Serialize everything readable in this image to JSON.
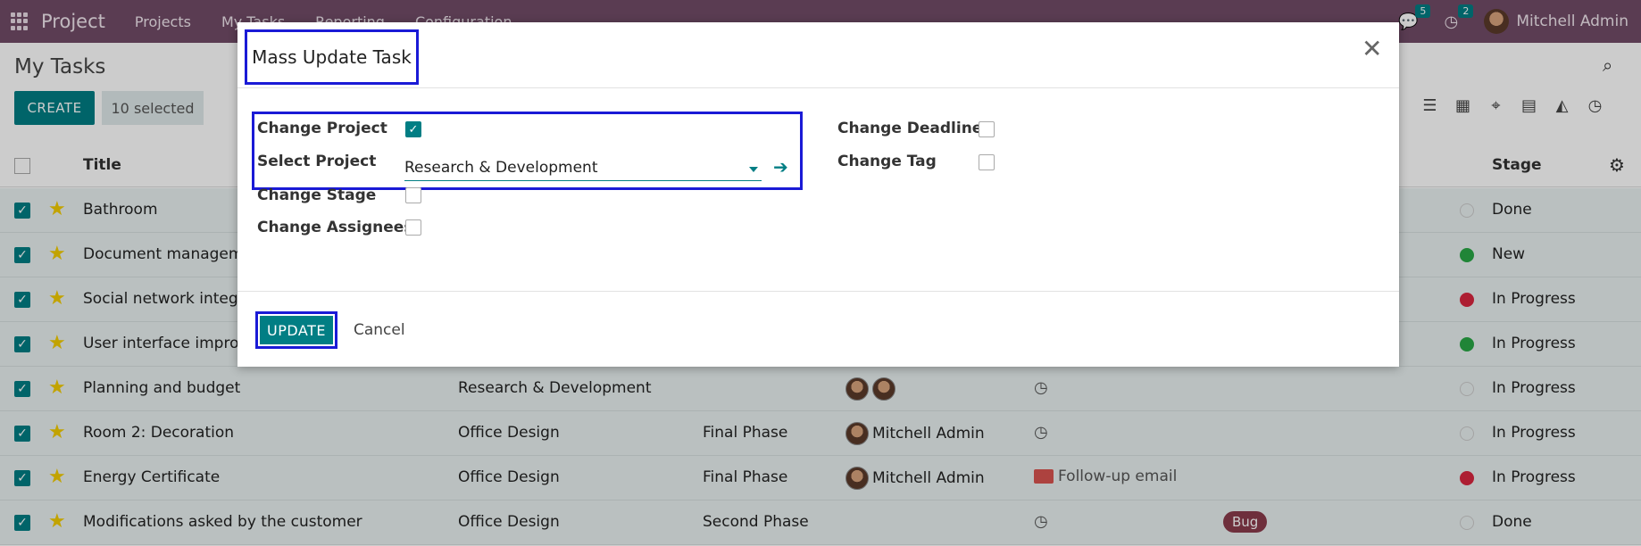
{
  "navbar": {
    "app_name": "Project",
    "menu": [
      "Projects",
      "My Tasks",
      "Reporting",
      "Configuration"
    ],
    "messages_count": "5",
    "activities_count": "2",
    "user_name": "Mitchell Admin"
  },
  "control_panel": {
    "page_title": "My Tasks",
    "create_label": "CREATE",
    "selected_label": "10 selected",
    "views": [
      "list-icon",
      "calendar-icon",
      "map-icon",
      "pivot-icon",
      "graph-icon",
      "activity-icon"
    ]
  },
  "table": {
    "headers": {
      "title": "Title",
      "stage": "Stage"
    },
    "rows": [
      {
        "title": "Bathroom",
        "project": "",
        "milestone": "",
        "assignees": "",
        "activity": "",
        "tag": "",
        "status": "none",
        "stage": "Done"
      },
      {
        "title": "Document management",
        "project": "",
        "milestone": "",
        "assignees": "",
        "activity": "",
        "tag": "",
        "status": "green",
        "stage": "New"
      },
      {
        "title": "Social network integration",
        "project": "",
        "milestone": "",
        "assignees": "",
        "activity": "",
        "tag": "",
        "status": "red",
        "stage": "In Progress"
      },
      {
        "title": "User interface improvements",
        "project": "",
        "milestone": "",
        "assignees": "",
        "activity": "",
        "tag": "",
        "status": "green",
        "stage": "In Progress"
      },
      {
        "title": "Planning and budget",
        "project": "Research & Development",
        "milestone": "",
        "assignees": "",
        "activity": "clock",
        "tag": "",
        "status": "none",
        "stage": "In Progress"
      },
      {
        "title": "Room 2: Decoration",
        "project": "Office Design",
        "milestone": "Final Phase",
        "assignees": "Mitchell Admin",
        "activity": "clock",
        "tag": "",
        "status": "none",
        "stage": "In Progress"
      },
      {
        "title": "Energy Certificate",
        "project": "Office Design",
        "milestone": "Final Phase",
        "assignees": "Mitchell Admin",
        "activity": "Follow-up email",
        "tag": "",
        "status": "red",
        "stage": "In Progress"
      },
      {
        "title": "Modifications asked by the customer",
        "project": "Office Design",
        "milestone": "Second Phase",
        "assignees": "",
        "activity": "clock",
        "tag": "Bug",
        "status": "none",
        "stage": "Done"
      }
    ]
  },
  "modal": {
    "title": "Mass Update Task",
    "fields": {
      "change_project": "Change Project",
      "select_project": "Select Project",
      "change_stage": "Change Stage",
      "change_assignees": "Change Assignees",
      "change_deadline": "Change Deadline",
      "change_tag": "Change Tag"
    },
    "select_project_value": "Research & Development",
    "update_label": "UPDATE",
    "cancel_label": "Cancel"
  },
  "colors": {
    "navbar": "#714B67",
    "primary": "#017E84",
    "highlight_box": "#1a1ad6"
  }
}
